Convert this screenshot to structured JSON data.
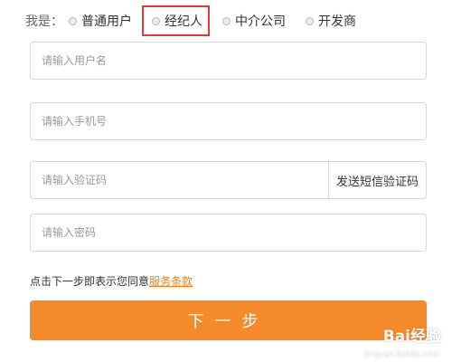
{
  "role": {
    "prefix": "我是：",
    "options": [
      {
        "label": "普通用户",
        "icon": "radio-unchecked-icon"
      },
      {
        "label": "经纪人",
        "icon": "radio-unchecked-icon"
      },
      {
        "label": "中介公司",
        "icon": "radio-unchecked-icon"
      },
      {
        "label": "开发商",
        "icon": "radio-unchecked-icon"
      }
    ],
    "highlight_color": "#e03b3b"
  },
  "form": {
    "username_placeholder": "请输入用户名",
    "phone_placeholder": "请输入手机号",
    "code_placeholder": "请输入验证码",
    "send_code_label": "发送短信验证码",
    "password_placeholder": "请输入密码"
  },
  "agreement": {
    "text": "点击下一步即表示您同意",
    "link": "服务条款",
    "link_color": "#f07f1b"
  },
  "next_button": {
    "label": "下一步",
    "color": "#f48a29"
  },
  "watermark": {
    "brand": "Bai经验",
    "sub": "jingyan.baidu.com"
  }
}
